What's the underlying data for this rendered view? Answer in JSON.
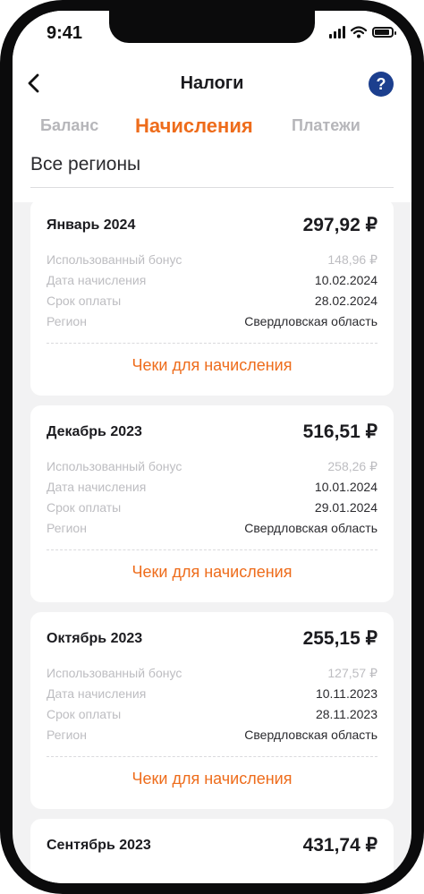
{
  "status_bar": {
    "time": "9:41"
  },
  "header": {
    "title": "Налоги",
    "help_label": "?"
  },
  "tabs": [
    {
      "label": "Баланс"
    },
    {
      "label": "Начисления"
    },
    {
      "label": "Платежи"
    }
  ],
  "region_filter": "Все регионы",
  "row_labels": {
    "bonus": "Использованный бонус",
    "accrual_date": "Дата начисления",
    "due_date": "Срок оплаты",
    "region": "Регион"
  },
  "cards": [
    {
      "month": "Январь 2024",
      "amount": "297,92 ₽",
      "bonus": "148,96 ₽",
      "accrual_date": "10.02.2024",
      "due_date": "28.02.2024",
      "region": "Свердловская область",
      "link": "Чеки для начисления"
    },
    {
      "month": "Декабрь 2023",
      "amount": "516,51 ₽",
      "bonus": "258,26 ₽",
      "accrual_date": "10.01.2024",
      "due_date": "29.01.2024",
      "region": "Свердловская область",
      "link": "Чеки для начисления"
    },
    {
      "month": "Октябрь 2023",
      "amount": "255,15 ₽",
      "bonus": "127,57 ₽",
      "accrual_date": "10.11.2023",
      "due_date": "28.11.2023",
      "region": "Свердловская область",
      "link": "Чеки для начисления"
    },
    {
      "month": "Сентябрь 2023",
      "amount": "431,74 ₽"
    }
  ],
  "colors": {
    "accent": "#ee6c1b",
    "help": "#1c3f8e",
    "background": "#f2f2f3"
  }
}
